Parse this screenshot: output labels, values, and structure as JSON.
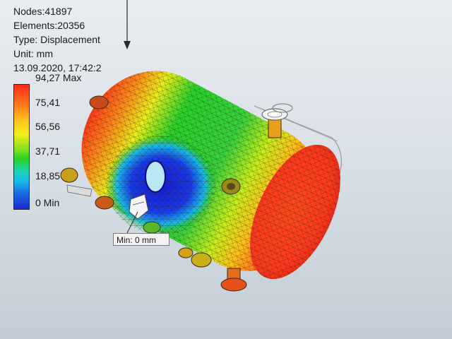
{
  "info": {
    "nodes": "Nodes:41897",
    "elements": "Elements:20356",
    "type": "Type: Displacement",
    "unit": "Unit: mm",
    "timestamp": "13.09.2020, 17:42:2"
  },
  "legend": {
    "max": "94,27 Max",
    "t1": "75,41",
    "t2": "56,56",
    "t3": "37,71",
    "t4": "18,85",
    "min": "0 Min"
  },
  "markers": {
    "min_tag": "Min: 0 mm"
  },
  "colors": {
    "max": "#ff2a1a",
    "min": "#1a2ad2"
  }
}
